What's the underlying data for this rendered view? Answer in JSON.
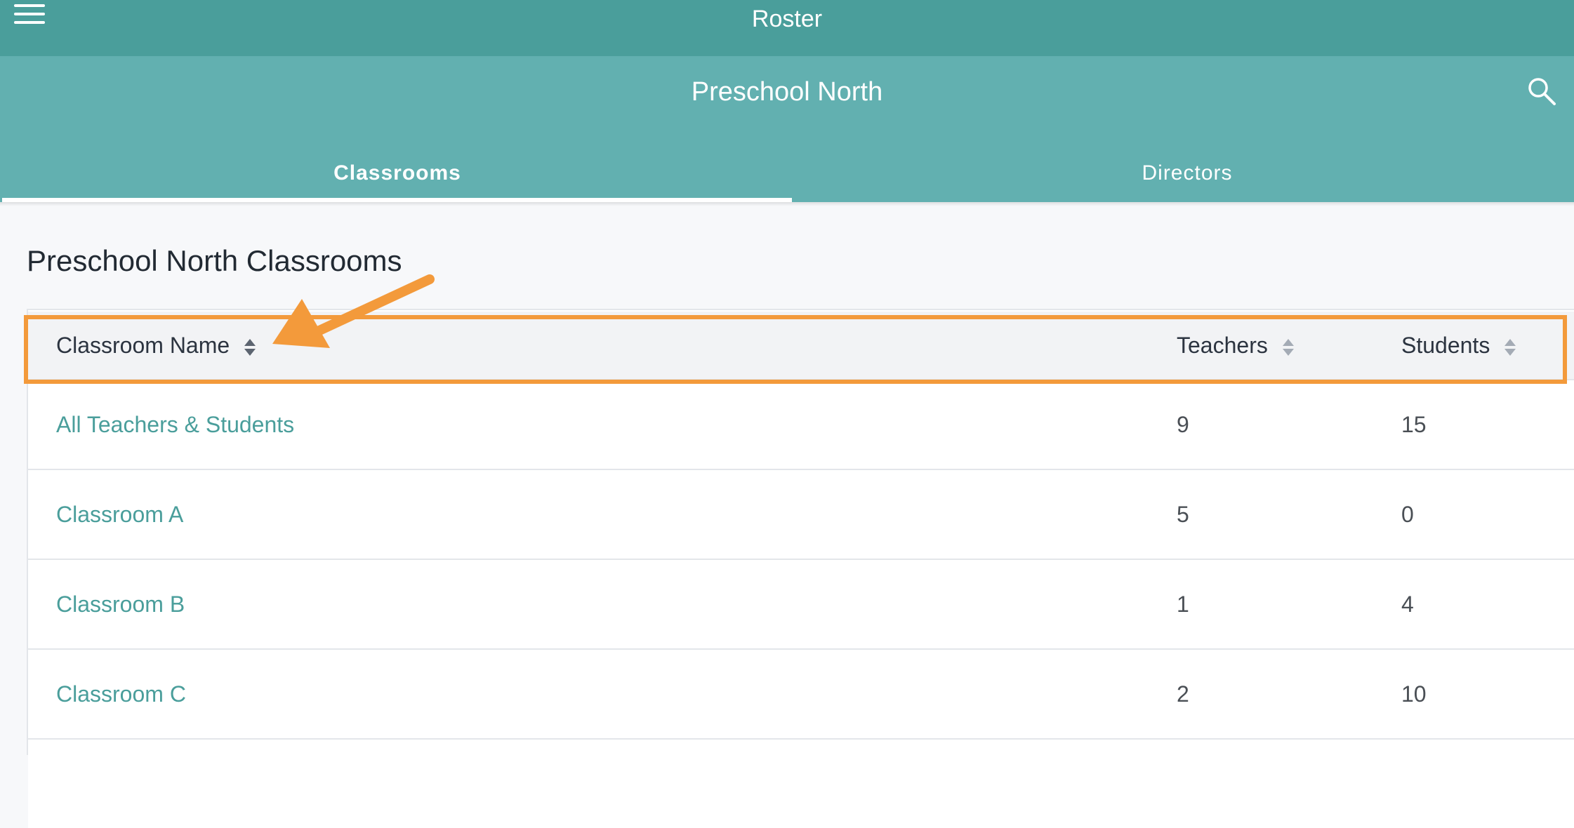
{
  "app": {
    "title": "Roster",
    "menu_icon": "hamburger-menu-icon"
  },
  "school": {
    "name": "Preschool North",
    "search_icon": "search-icon"
  },
  "tabs": [
    {
      "label": "Classrooms",
      "active": true
    },
    {
      "label": "Directors",
      "active": false
    }
  ],
  "section": {
    "title": "Preschool North Classrooms"
  },
  "table": {
    "columns": [
      {
        "label": "Classroom Name",
        "sortable": true
      },
      {
        "label": "Teachers",
        "sortable": true
      },
      {
        "label": "Students",
        "sortable": true
      }
    ],
    "rows": [
      {
        "name": "All Teachers & Students",
        "teachers": "9",
        "students": "15"
      },
      {
        "name": "Classroom A",
        "teachers": "5",
        "students": "0"
      },
      {
        "name": "Classroom B",
        "teachers": "1",
        "students": "4"
      },
      {
        "name": "Classroom C",
        "teachers": "2",
        "students": "10"
      }
    ]
  },
  "colors": {
    "topbar": "#4a9e9b",
    "subheader": "#62b0b0",
    "link": "#4a9e9b",
    "annotation": "#f39a3b"
  }
}
